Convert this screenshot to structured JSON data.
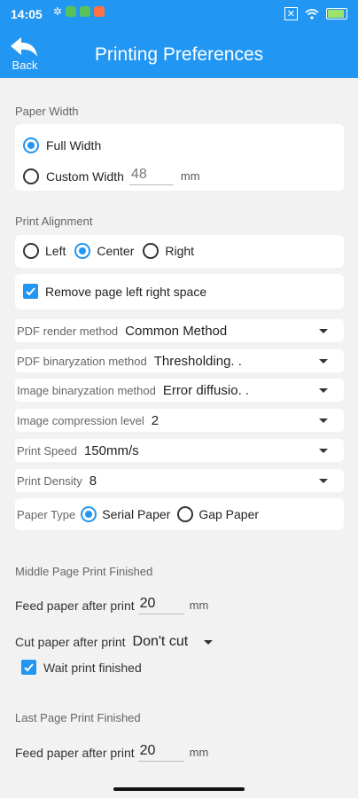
{
  "status_bar": {
    "time": "14:05",
    "battery": "96"
  },
  "app_bar": {
    "back_label": "Back",
    "title": "Printing Preferences"
  },
  "paper_width": {
    "label": "Paper Width",
    "full_width": "Full Width",
    "custom_width": "Custom Width",
    "custom_placeholder": "48",
    "unit": "mm"
  },
  "alignment": {
    "label": "Print Alignment",
    "left": "Left",
    "center": "Center",
    "right": "Right"
  },
  "remove_space": {
    "label": "Remove page left right space"
  },
  "selects": {
    "pdf_render": {
      "label": "PDF render method",
      "value": "Common Method"
    },
    "pdf_binary": {
      "label": "PDF binaryzation method",
      "value": "Thresholding. ."
    },
    "image_binary": {
      "label": "Image binaryzation method",
      "value": "Error diffusio. ."
    },
    "compression": {
      "label": "Image compression level",
      "value": "2"
    },
    "speed": {
      "label": "Print Speed",
      "value": "150mm/s"
    },
    "density": {
      "label": "Print Density",
      "value": "8"
    }
  },
  "paper_type": {
    "label": "Paper Type",
    "serial": "Serial Paper",
    "gap": "Gap Paper"
  },
  "middle_page": {
    "label": "Middle Page Print Finished",
    "feed_label": "Feed paper after print",
    "feed_value": "20",
    "unit": "mm",
    "cut_label": "Cut paper after print",
    "cut_value": "Don't cut",
    "wait_label": "Wait print finished"
  },
  "last_page": {
    "label": "Last Page Print Finished",
    "feed_label": "Feed paper after print",
    "feed_value": "20",
    "unit": "mm"
  }
}
